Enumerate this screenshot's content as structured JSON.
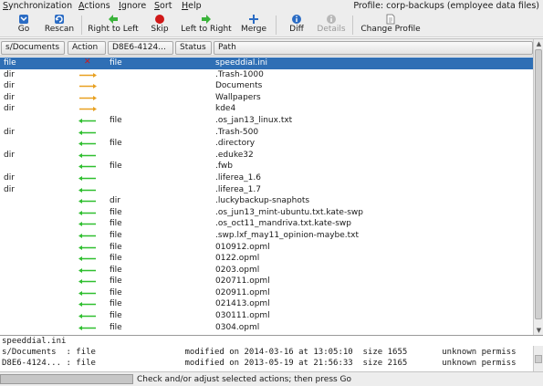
{
  "menubar": {
    "items": [
      "Synchronization",
      "Actions",
      "Ignore",
      "Sort",
      "Help"
    ],
    "profile": "Profile: corp-backups (employee data files)"
  },
  "toolbar": {
    "buttons": [
      {
        "label": "Go",
        "icon": "go-icon",
        "enabled": true
      },
      {
        "label": "Rescan",
        "icon": "rescan-icon",
        "enabled": true
      },
      {
        "label": "Right to Left",
        "icon": "right-to-left-icon",
        "enabled": true
      },
      {
        "label": "Skip",
        "icon": "skip-icon",
        "enabled": true
      },
      {
        "label": "Left to Right",
        "icon": "left-to-right-icon",
        "enabled": true
      },
      {
        "label": "Merge",
        "icon": "merge-icon",
        "enabled": true
      },
      {
        "label": "Diff",
        "icon": "diff-icon",
        "enabled": true
      },
      {
        "label": "Details",
        "icon": "details-icon",
        "enabled": false
      },
      {
        "label": "Change Profile",
        "icon": "change-profile-icon",
        "enabled": true
      }
    ],
    "colors": {
      "go": "#2b6cc4",
      "green": "#3ab33a",
      "skip": "#d01818",
      "merge": "#2b6cc4",
      "info": "#2b6cc4"
    }
  },
  "table": {
    "columns": [
      "s/Documents",
      "Action",
      "D8E6-4124...",
      "Status",
      "Path"
    ],
    "colors": {
      "selected": "#2f6fb5",
      "left_arrow": "#2fbf2f",
      "right_arrow": "#e8a020"
    },
    "rows": [
      {
        "a": "file",
        "action": "conflict",
        "b": "file",
        "path": "speeddial.ini",
        "selected": true
      },
      {
        "a": "dir",
        "action": "right",
        "b": "",
        "path": ".Trash-1000"
      },
      {
        "a": "dir",
        "action": "right",
        "b": "",
        "path": "Documents"
      },
      {
        "a": "dir",
        "action": "right",
        "b": "",
        "path": "Wallpapers"
      },
      {
        "a": "dir",
        "action": "right",
        "b": "",
        "path": "kde4"
      },
      {
        "a": "",
        "action": "left",
        "b": "file",
        "path": ".os_jan13_linux.txt"
      },
      {
        "a": "dir",
        "action": "left",
        "b": "",
        "path": ".Trash-500"
      },
      {
        "a": "",
        "action": "left",
        "b": "file",
        "path": ".directory"
      },
      {
        "a": "dir",
        "action": "left",
        "b": "",
        "path": ".eduke32"
      },
      {
        "a": "",
        "action": "left",
        "b": "file",
        "path": ".fwb"
      },
      {
        "a": "dir",
        "action": "left",
        "b": "",
        "path": ".liferea_1.6"
      },
      {
        "a": "dir",
        "action": "left",
        "b": "",
        "path": ".liferea_1.7"
      },
      {
        "a": "",
        "action": "left",
        "b": "dir",
        "path": ".luckybackup-snaphots"
      },
      {
        "a": "",
        "action": "left",
        "b": "file",
        "path": ".os_jun13_mint-ubuntu.txt.kate-swp"
      },
      {
        "a": "",
        "action": "left",
        "b": "file",
        "path": ".os_oct11_mandriva.txt.kate-swp"
      },
      {
        "a": "",
        "action": "left",
        "b": "file",
        "path": ".swp.lxf_may11_opinion-maybe.txt"
      },
      {
        "a": "",
        "action": "left",
        "b": "file",
        "path": "010912.opml"
      },
      {
        "a": "",
        "action": "left",
        "b": "file",
        "path": "0122.opml"
      },
      {
        "a": "",
        "action": "left",
        "b": "file",
        "path": "0203.opml"
      },
      {
        "a": "",
        "action": "left",
        "b": "file",
        "path": "020711.opml"
      },
      {
        "a": "",
        "action": "left",
        "b": "file",
        "path": "020911.opml"
      },
      {
        "a": "",
        "action": "left",
        "b": "file",
        "path": "021413.opml"
      },
      {
        "a": "",
        "action": "left",
        "b": "file",
        "path": "030111.opml"
      },
      {
        "a": "",
        "action": "left",
        "b": "file",
        "path": "0304.opml"
      }
    ]
  },
  "info": {
    "filename": "speeddial.ini",
    "lines": [
      "s/Documents  : file                  modified on 2014-03-16 at 13:05:10  size 1655       unknown permiss",
      "D8E6-4124... : file                  modified on 2013-05-19 at 21:56:33  size 2165       unknown permiss"
    ]
  },
  "status": {
    "text": "Check and/or adjust selected actions; then press Go"
  }
}
